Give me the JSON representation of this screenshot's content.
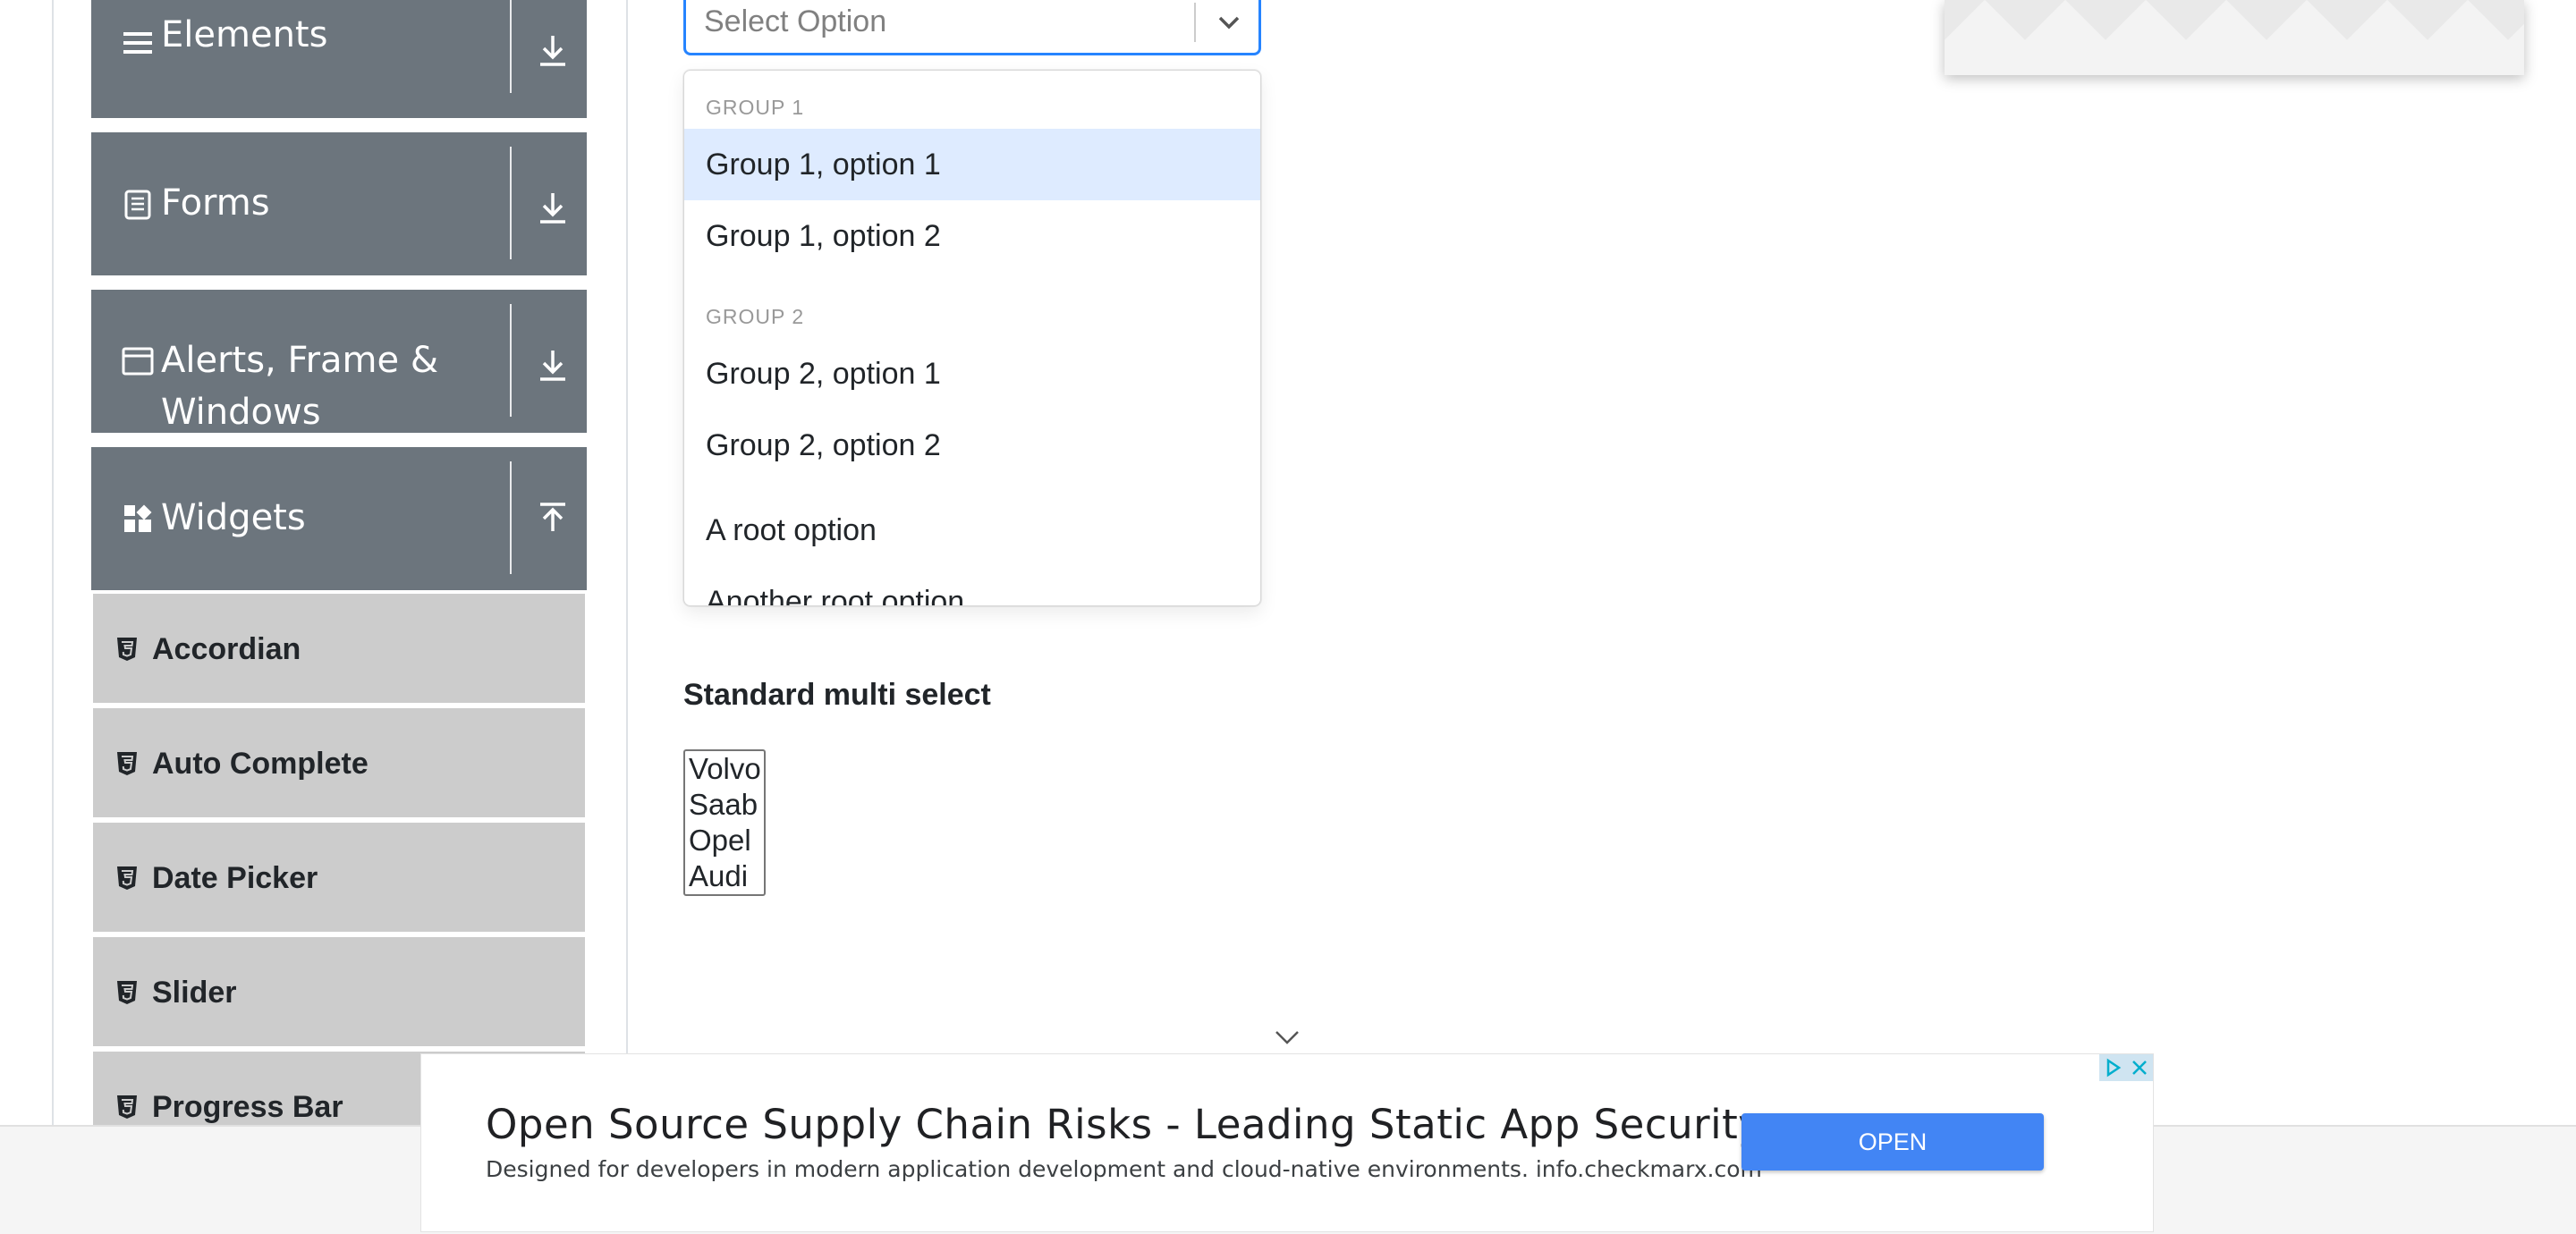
{
  "sidebar": {
    "groups": [
      {
        "label": "Elements",
        "icon": "hamburger-icon",
        "state": "collapsed"
      },
      {
        "label": "Forms",
        "icon": "document-icon",
        "state": "collapsed"
      },
      {
        "label_line1": "Alerts, Frame &",
        "label_line2": "Windows",
        "icon": "window-icon",
        "state": "collapsed"
      },
      {
        "label": "Widgets",
        "icon": "widgets-icon",
        "state": "expanded"
      }
    ],
    "widget_items": [
      {
        "label": "Accordian",
        "icon": "html5-icon"
      },
      {
        "label": "Auto Complete",
        "icon": "html5-icon"
      },
      {
        "label": "Date Picker",
        "icon": "html5-icon"
      },
      {
        "label": "Slider",
        "icon": "html5-icon"
      },
      {
        "label": "Progress Bar",
        "icon": "html5-icon"
      }
    ]
  },
  "select": {
    "placeholder": "Select Option",
    "menu": {
      "group1_heading": "GROUP 1",
      "group1_options": [
        "Group 1, option 1",
        "Group 1, option 2"
      ],
      "group2_heading": "GROUP 2",
      "group2_options": [
        "Group 2, option 1",
        "Group 2, option 2"
      ],
      "root_options": [
        "A root option",
        "Another root option"
      ],
      "focused_option": "Group 1, option 1"
    }
  },
  "multi_select": {
    "label": "Standard multi select",
    "options": [
      "Volvo",
      "Saab",
      "Opel",
      "Audi"
    ]
  },
  "ad": {
    "title": "Open Source Supply Chain Risks - Leading Static App Security",
    "description": "Designed for developers in modern application development and cloud-native environments. info.checkmarx.com",
    "button_label": "OPEN",
    "button_color": "#4285f4"
  },
  "colors": {
    "sidebar_header": "#6c757d",
    "sidebar_item": "#cccccc",
    "select_focus_border": "#2684ff",
    "option_focus": "#deebff"
  }
}
